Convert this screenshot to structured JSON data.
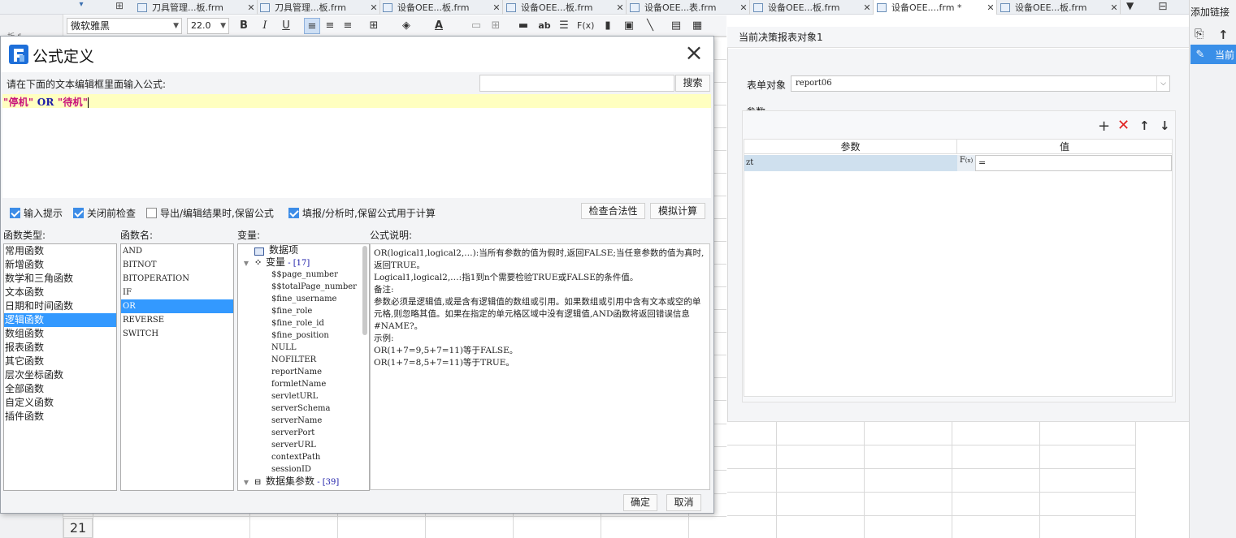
{
  "app": {
    "tabs": [
      {
        "label": "刀具管理...板.frm",
        "active": false
      },
      {
        "label": "刀具管理...板.frm",
        "active": false
      },
      {
        "label": "设备OEE...板.frm",
        "active": false
      },
      {
        "label": "设备OEE...板.frm",
        "active": false
      },
      {
        "label": "设备OEE...表.frm",
        "active": false
      },
      {
        "label": "设备OEE...板.frm",
        "active": false
      },
      {
        "label": "设备OEE....frm *",
        "active": true
      },
      {
        "label": "设备OEE...板.frm",
        "active": false
      }
    ],
    "toolbar": {
      "font_name": "微软雅黑",
      "font_size": "22.0"
    },
    "row_number": "21",
    "right_panel": {
      "title": "当前决策报表对象1",
      "form_object_label": "表单对象",
      "form_object_value": "report06",
      "params_label": "参数",
      "col_param": "参数",
      "col_value": "值",
      "row_param": "zt",
      "row_value": "="
    },
    "far_right": {
      "title": "添加链接",
      "current_label": "当前"
    }
  },
  "dialog": {
    "title": "公式定义",
    "prompt": "请在下面的文本编辑框里面输入公式:",
    "search_placeholder": "",
    "search_button": "搜索",
    "formula": {
      "part1": "\"停机\"",
      "op": " OR ",
      "part2": "\"待机\""
    },
    "checkboxes": [
      {
        "label": "输入提示",
        "checked": true
      },
      {
        "label": "关闭前检查",
        "checked": true
      },
      {
        "label": "导出/编辑结果时,保留公式",
        "checked": false
      },
      {
        "label": "填报/分析时,保留公式用于计算",
        "checked": true
      }
    ],
    "check_button": "检查合法性",
    "simulate_button": "模拟计算",
    "func_type_label": "函数类型:",
    "func_name_label": "函数名:",
    "variable_label": "变量:",
    "desc_label": "公式说明:",
    "func_types": [
      "常用函数",
      "新增函数",
      "数学和三角函数",
      "文本函数",
      "日期和时间函数",
      "逻辑函数",
      "数组函数",
      "报表函数",
      "其它函数",
      "层次坐标函数",
      "全部函数",
      "自定义函数",
      "插件函数"
    ],
    "func_type_selected": 5,
    "func_names": [
      "AND",
      "BITNOT",
      "BITOPERATION",
      "IF",
      "OR",
      "REVERSE",
      "SWITCH"
    ],
    "func_name_selected": 4,
    "variables": {
      "data_item": "数据项",
      "var_group": "变量",
      "var_count": " - [17]",
      "var_items": [
        "$$page_number",
        "$$totalPage_number",
        "$fine_username",
        "$fine_role",
        "$fine_role_id",
        "$fine_position",
        "NULL",
        "NOFILTER",
        "reportName",
        "formletName",
        "servletURL",
        "serverSchema",
        "serverName",
        "serverPort",
        "serverURL",
        "contextPath",
        "sessionID"
      ],
      "dataset_group": "数据集参数",
      "dataset_count": " - [39]"
    },
    "description": [
      "OR(logical1,logical2,…):当所有参数的值为假时,返回FALSE;当任意参数的值为真时,返回TRUE。",
      "Logical1,logical2,…:指1到n个需要检验TRUE或FALSE的条件值。",
      "备注:",
      "参数必须是逻辑值,或是含有逻辑值的数组或引用。如果数组或引用中含有文本或空的单元格,则忽略其值。如果在指定的单元格区域中没有逻辑值,AND函数将返回错误信息#NAME?。",
      "示例:",
      "OR(1+7=9,5+7=11)等于FALSE。",
      "OR(1+7=8,5+7=11)等于TRUE。"
    ],
    "ok_button": "确定",
    "cancel_button": "取消"
  }
}
